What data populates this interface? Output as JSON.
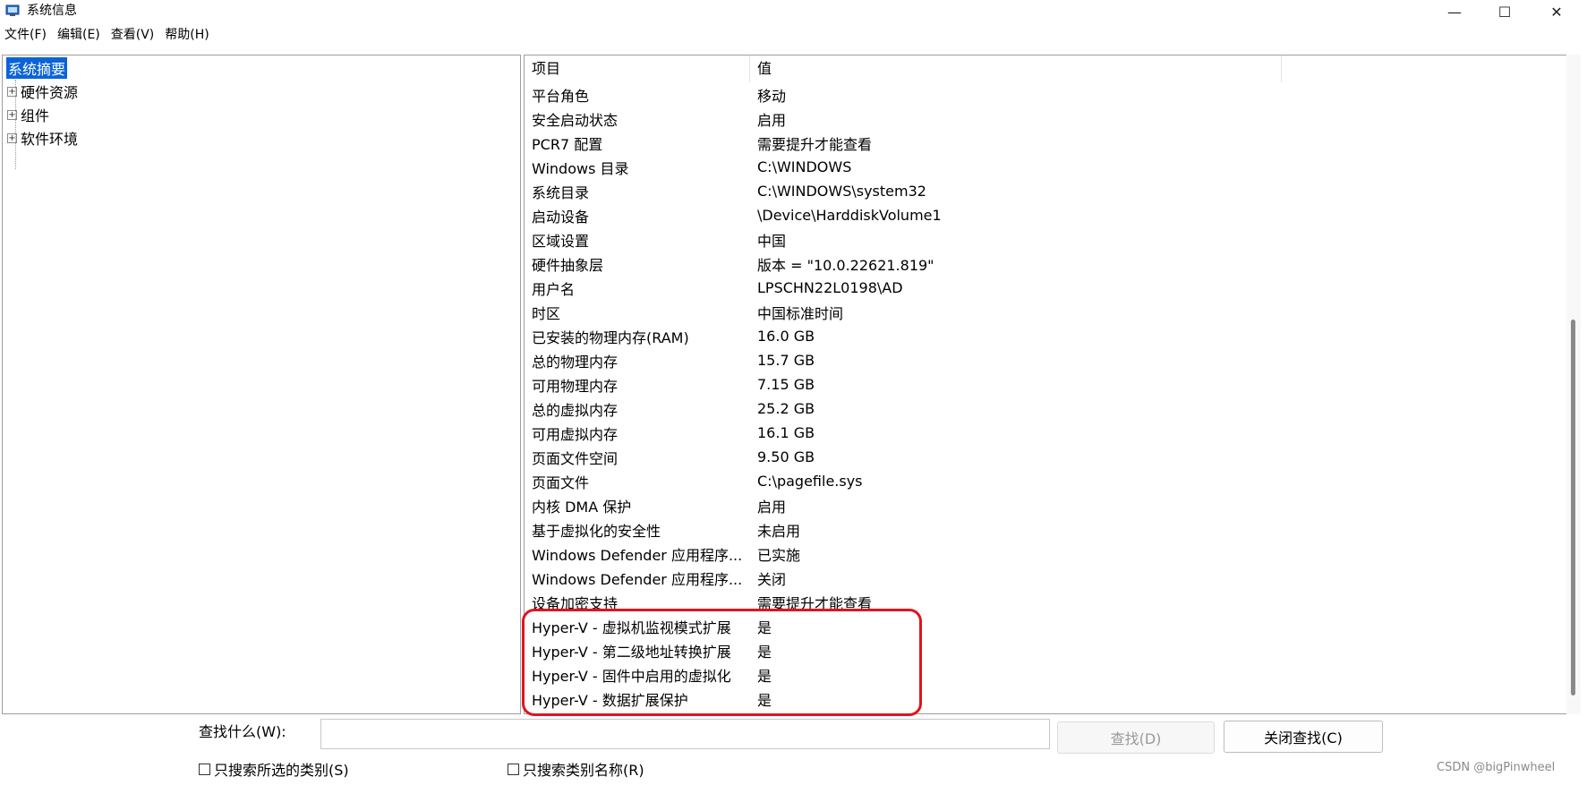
{
  "window": {
    "title": "系统信息",
    "controls": {
      "minimize": "—",
      "maximize": "☐",
      "close": "✕"
    }
  },
  "menu": [
    "文件(F)",
    "编辑(E)",
    "查看(V)",
    "帮助(H)"
  ],
  "tree": {
    "selected": "系统摘要",
    "nodes": [
      "硬件资源",
      "组件",
      "软件环境"
    ]
  },
  "list": {
    "headers": {
      "item": "项目",
      "value": "值"
    },
    "rows": [
      {
        "item": "平台角色",
        "value": "移动"
      },
      {
        "item": "安全启动状态",
        "value": "启用"
      },
      {
        "item": "PCR7 配置",
        "value": "需要提升才能查看"
      },
      {
        "item": "Windows 目录",
        "value": "C:\\WINDOWS"
      },
      {
        "item": "系统目录",
        "value": "C:\\WINDOWS\\system32"
      },
      {
        "item": "启动设备",
        "value": "\\Device\\HarddiskVolume1"
      },
      {
        "item": "区域设置",
        "value": "中国"
      },
      {
        "item": "硬件抽象层",
        "value": "版本 = \"10.0.22621.819\""
      },
      {
        "item": "用户名",
        "value": "LPSCHN22L0198\\AD"
      },
      {
        "item": "时区",
        "value": "中国标准时间"
      },
      {
        "item": "已安装的物理内存(RAM)",
        "value": "16.0 GB"
      },
      {
        "item": "总的物理内存",
        "value": "15.7 GB"
      },
      {
        "item": "可用物理内存",
        "value": "7.15 GB"
      },
      {
        "item": "总的虚拟内存",
        "value": "25.2 GB"
      },
      {
        "item": "可用虚拟内存",
        "value": "16.1 GB"
      },
      {
        "item": "页面文件空间",
        "value": "9.50 GB"
      },
      {
        "item": "页面文件",
        "value": "C:\\pagefile.sys"
      },
      {
        "item": "内核 DMA 保护",
        "value": "启用"
      },
      {
        "item": "基于虚拟化的安全性",
        "value": "未启用"
      },
      {
        "item": "Windows Defender 应用程序...",
        "value": "已实施"
      },
      {
        "item": "Windows Defender 应用程序...",
        "value": "关闭"
      },
      {
        "item": "设备加密支持",
        "value": "需要提升才能查看"
      },
      {
        "item": "Hyper-V - 虚拟机监视模式扩展",
        "value": "是"
      },
      {
        "item": "Hyper-V - 第二级地址转换扩展",
        "value": "是"
      },
      {
        "item": "Hyper-V - 固件中启用的虚拟化",
        "value": "是"
      },
      {
        "item": "Hyper-V - 数据扩展保护",
        "value": "是"
      }
    ]
  },
  "search": {
    "label": "查找什么(W):",
    "value": "",
    "find_button": "查找(D)",
    "close_button": "关闭查找(C)",
    "option_selected_category": "只搜索所选的类别(S)",
    "option_category_names": "只搜索类别名称(R)"
  },
  "watermark": "CSDN @bigPinwheel",
  "colors": {
    "selection": "#0a64d8",
    "highlight": "#e0141e"
  }
}
